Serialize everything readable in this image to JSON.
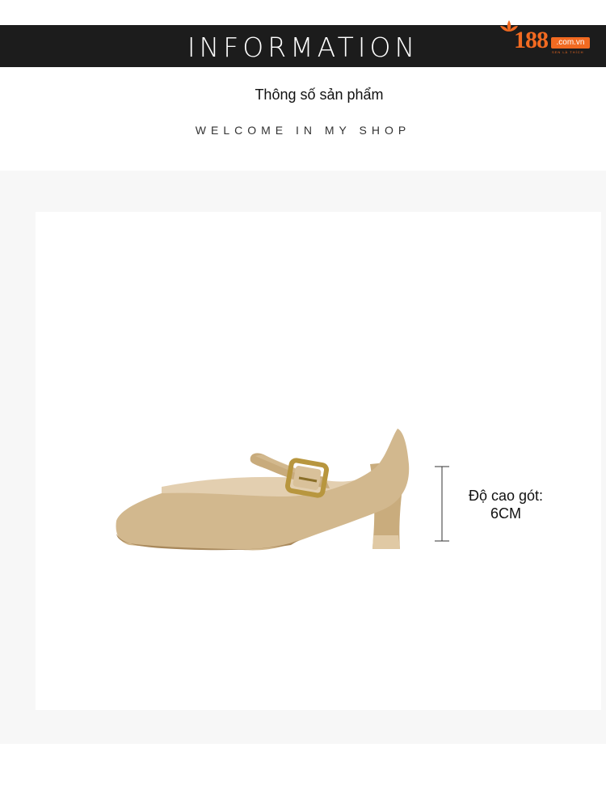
{
  "header": {
    "band_title": "INFORMATION",
    "logo": {
      "number": "188",
      "domain": ".com.vn",
      "tagline": "SEN LÀ THÍCH",
      "brand_color": "#f26a21"
    },
    "heading": "Thông số sản phẩm",
    "subheading": "WELCOME IN MY SHOP"
  },
  "product": {
    "image": "beige-mary-jane-heel-shoe",
    "heel_label": "Độ cao gót:",
    "heel_value": "6CM"
  },
  "colors": {
    "band": "#1c1c1c",
    "panel": "#f7f7f7",
    "shoe": "#d2b88e"
  }
}
